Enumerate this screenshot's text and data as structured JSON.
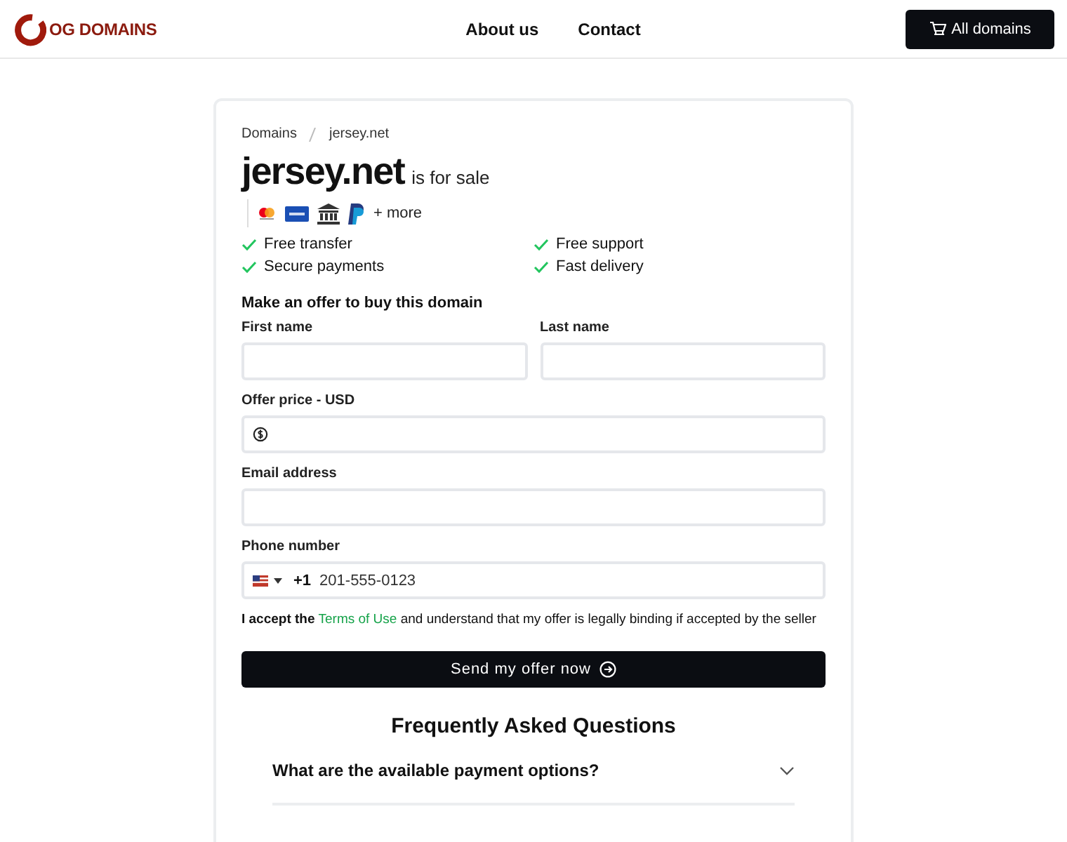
{
  "header": {
    "logo_text": "OG DOMAINS",
    "nav": [
      "About us",
      "Contact"
    ],
    "cta": "All domains"
  },
  "breadcrumb": [
    "Domains",
    "jersey.net"
  ],
  "domain": "jersey.net",
  "sale_note": "is for sale",
  "payment_more": "+ more",
  "features": [
    "Free transfer",
    "Free support",
    "Secure payments",
    "Fast delivery"
  ],
  "form": {
    "title": "Make an offer to buy this domain",
    "fields": [
      {
        "kind": "text",
        "label": "First name",
        "half": true
      },
      {
        "kind": "text",
        "label": "Last name",
        "half": true
      },
      {
        "kind": "money",
        "label": "Offer price - USD",
        "half": false
      },
      {
        "kind": "text",
        "label": "Email address",
        "half": false
      },
      {
        "kind": "phone",
        "label": "Phone number",
        "half": false,
        "prefix": "+1",
        "placeholder": "201-555-0123"
      }
    ],
    "terms": {
      "before": "I accept the",
      "link": "Terms of Use",
      "after": "and understand that my offer is legally binding if accepted by the seller"
    },
    "submit": "Send my offer now"
  },
  "faq": {
    "title": "Frequently Asked Questions",
    "items": [
      {
        "question": "What are the available payment options?",
        "expanded": false
      }
    ]
  }
}
